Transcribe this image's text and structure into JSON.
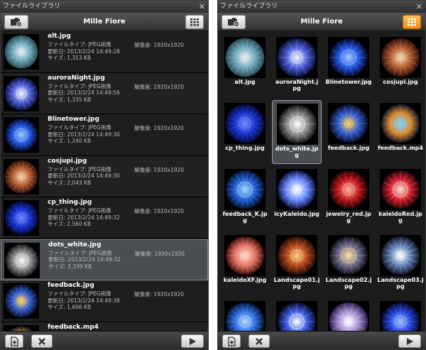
{
  "window": {
    "title": "ファイルライブラリ",
    "close_label": "✕"
  },
  "toolbar": {
    "title": "Mille Fiore"
  },
  "labels": {
    "filetype_prefix": "ファイルタイプ: ",
    "updated_prefix": "更新日: ",
    "size_prefix": "サイズ: ",
    "resolution_prefix": "解像度: "
  },
  "files": [
    {
      "name": "alt.jpg",
      "type": "JPEG画像",
      "updated": "2013/2/24 14:49:28",
      "size": "1,313 KB",
      "resolution": "1920x1920",
      "selected": false,
      "colors": [
        "#e6eef0",
        "#6aa7b7",
        "#2a4a55"
      ]
    },
    {
      "name": "auroraNight.jpg",
      "type": "JPEG画像",
      "updated": "2013/2/24 14:49:56",
      "size": "1,335 KB",
      "resolution": "1920x1920",
      "selected": false,
      "colors": [
        "#f4f6ff",
        "#4a5bd8",
        "#0b0f3a"
      ]
    },
    {
      "name": "Blinetower.jpg",
      "type": "JPEG画像",
      "updated": "2013/2/24 14:49:30",
      "size": "1,240 KB",
      "resolution": "1920x1920",
      "selected": false,
      "colors": [
        "#9fc8ff",
        "#1f4fe0",
        "#020418"
      ]
    },
    {
      "name": "cosjupi.jpg",
      "type": "JPEG画像",
      "updated": "2013/2/24 14:49:30",
      "size": "2,043 KB",
      "resolution": "1920x1920",
      "selected": false,
      "colors": [
        "#f3d3b0",
        "#b0542c",
        "#2a0f0a"
      ]
    },
    {
      "name": "cp_thing.jpg",
      "type": "JPEG画像",
      "updated": "2013/2/24 14:49:32",
      "size": "2,560 KB",
      "resolution": "1920x1920",
      "selected": false,
      "colors": [
        "#6f8cff",
        "#1730c8",
        "#030a3a"
      ]
    },
    {
      "name": "dots_white.jpg",
      "type": "JPEG画像",
      "updated": "2013/2/24 14:49:32",
      "size": "2,339 KB",
      "resolution": "1920x1920",
      "selected": true,
      "colors": [
        "#ffffff",
        "#8a8a8a",
        "#111111"
      ]
    },
    {
      "name": "feedback.jpg",
      "type": "JPEG画像",
      "updated": "2013/2/24 14:49:38",
      "size": "1,606 KB",
      "resolution": "1920x1920",
      "selected": false,
      "colors": [
        "#ffd066",
        "#2a5ad8",
        "#0a0a20"
      ]
    },
    {
      "name": "feedback.mp4",
      "type": "",
      "updated": "",
      "size": "",
      "resolution": "",
      "selected": false,
      "colors": [
        "#7fd0ff",
        "#e08a2a",
        "#101020"
      ]
    }
  ],
  "grid_items": [
    {
      "label": "alt.jpg",
      "selected": false,
      "colors": [
        "#e6eef0",
        "#6aa7b7",
        "#2a4a55"
      ]
    },
    {
      "label": "auroraNight.jpg",
      "selected": false,
      "colors": [
        "#f4f6ff",
        "#4a5bd8",
        "#0b0f3a"
      ]
    },
    {
      "label": "Blinetower.jpg",
      "selected": false,
      "colors": [
        "#9fc8ff",
        "#1f4fe0",
        "#020418"
      ]
    },
    {
      "label": "cosjupi.jpg",
      "selected": false,
      "colors": [
        "#f3d3b0",
        "#b0542c",
        "#2a0f0a"
      ]
    },
    {
      "label": "cp_thing.jpg",
      "selected": false,
      "colors": [
        "#6f8cff",
        "#1730c8",
        "#030a3a"
      ]
    },
    {
      "label": "dots_white.jpg",
      "selected": true,
      "colors": [
        "#ffffff",
        "#8a8a8a",
        "#111111"
      ]
    },
    {
      "label": "feedback.jpg",
      "selected": false,
      "colors": [
        "#ffd066",
        "#2a5ad8",
        "#0a0a20"
      ]
    },
    {
      "label": "feedback.mp4",
      "selected": false,
      "colors": [
        "#7fd0ff",
        "#e08a2a",
        "#101020"
      ]
    },
    {
      "label": "feedback_K.jpg",
      "selected": false,
      "colors": [
        "#9fd8ff",
        "#1e5ad0",
        "#041030"
      ]
    },
    {
      "label": "icyKaleido.jpg",
      "selected": false,
      "colors": [
        "#ffffff",
        "#6a8cff",
        "#0a1040"
      ]
    },
    {
      "label": "jewelry_red.jpg",
      "selected": false,
      "colors": [
        "#ffb0a0",
        "#c0141a",
        "#1a0205"
      ]
    },
    {
      "label": "kaleidoRed.jpg",
      "selected": false,
      "colors": [
        "#ffe0d0",
        "#d01a2a",
        "#200408"
      ]
    },
    {
      "label": "kaleidoXF.jpg",
      "selected": false,
      "colors": [
        "#ffd8c8",
        "#e07060",
        "#3a0a08"
      ]
    },
    {
      "label": "Landscape01.jpg",
      "selected": false,
      "colors": [
        "#ffd080",
        "#b0401a",
        "#200a04"
      ]
    },
    {
      "label": "Landscape02.jpg",
      "selected": false,
      "colors": [
        "#ffe0a0",
        "#6a6a8a",
        "#0a0a14"
      ]
    },
    {
      "label": "Landscape03.jpg",
      "selected": false,
      "colors": [
        "#ffffff",
        "#5a7ab0",
        "#101420"
      ]
    },
    {
      "label": "",
      "selected": false,
      "colors": [
        "#b0d8ff",
        "#2a6ae0",
        "#041030"
      ]
    },
    {
      "label": "",
      "selected": false,
      "colors": [
        "#ffffff",
        "#3a5ae0",
        "#050a2a"
      ]
    },
    {
      "label": "",
      "selected": false,
      "colors": [
        "#ffffff",
        "#a08ad0",
        "#2a1a4a"
      ]
    },
    {
      "label": "",
      "selected": false,
      "colors": [
        "#a0c0ff",
        "#2040e0",
        "#030820"
      ]
    }
  ]
}
